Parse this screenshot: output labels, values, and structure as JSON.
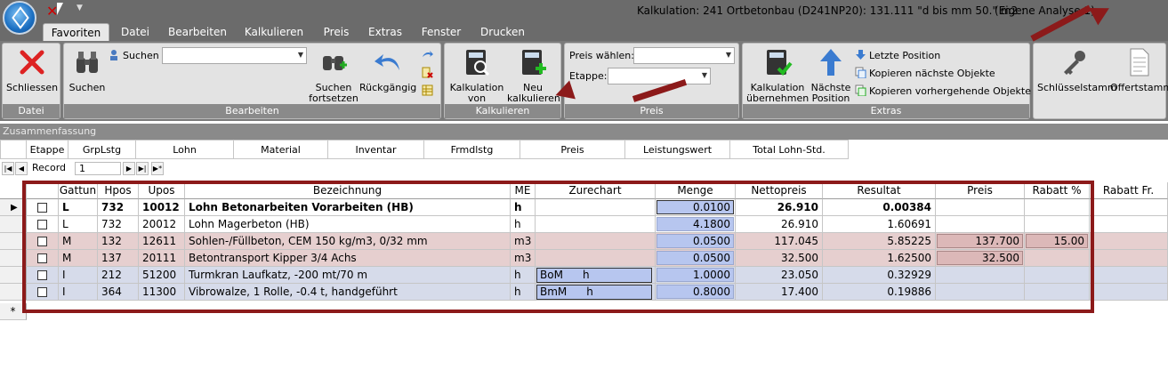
{
  "title": {
    "main": "Kalkulation: 241 Ortbetonbau (D241NP20): 131.111   \"d bis mm 50.\" m2 :",
    "extra": "(Eigene Analyse 1)"
  },
  "tabs": [
    "Favoriten",
    "Datei",
    "Bearbeiten",
    "Kalkulieren",
    "Preis",
    "Extras",
    "Fenster",
    "Drucken"
  ],
  "ribbon": {
    "datei": {
      "label": "Datei",
      "close": "Schliessen"
    },
    "bearbeiten": {
      "label": "Bearbeiten",
      "suchen_big": "Suchen",
      "suchen_small": "Suchen",
      "search_value": "",
      "continue_line1": "Suchen",
      "continue_line2": "fortsetzen",
      "undo": "Rückgängig"
    },
    "kalkulieren": {
      "label": "Kalkulieren",
      "von_line1": "Kalkulation",
      "von_line2": "von",
      "neu_line1": "Neu",
      "neu_line2": "kalkulieren"
    },
    "preis": {
      "label": "Preis",
      "preis_waehlen": "Preis wählen:",
      "preis_value": "",
      "etappe": "Etappe:",
      "etappe_value": ""
    },
    "extras": {
      "label": "Extras",
      "uebernehmen_line1": "Kalkulation",
      "uebernehmen_line2": "übernehmen",
      "naechste_line1": "Nächste",
      "naechste_line2": "Position",
      "letzte": "Letzte Position",
      "kopieren_naechste": "Kopieren nächste Objekte",
      "kopieren_vorher": "Kopieren vorhergehende Objekte"
    },
    "extra2": {
      "schluessel": "Schlüsselstamm",
      "offert": "Offertstamm"
    }
  },
  "summary": {
    "title": "Zusammenfassung",
    "columns": [
      "Etappe",
      "GrpLstg",
      "Lohn",
      "Material",
      "Inventar",
      "Frmdlstg",
      "Preis",
      "Leistungswert",
      "Total Lohn-Std."
    ]
  },
  "navigator": {
    "label": "Record",
    "value": "1"
  },
  "grid": {
    "headers": [
      "Gattun",
      "Hpos",
      "Upos",
      "Bezeichnung",
      "ME",
      "Zurechart",
      "Menge",
      "Nettopreis",
      "Resultat",
      "Preis",
      "Rabatt %",
      "Rabatt Fr."
    ],
    "rows": [
      {
        "g": "L",
        "h": "732",
        "u": "10012",
        "bez": "Lohn Betonarbeiten Vorarbeiten (HB)",
        "me": "h",
        "zur": "",
        "zur2": "",
        "menge": "0.0100",
        "netto": "26.910",
        "res": "0.00384",
        "preis": "",
        "rab": "",
        "rabfr": "",
        "bold": true,
        "tint": "#ffffff"
      },
      {
        "g": "L",
        "h": "732",
        "u": "20012",
        "bez": "Lohn Magerbeton (HB)",
        "me": "h",
        "zur": "",
        "zur2": "",
        "menge": "4.1800",
        "netto": "26.910",
        "res": "1.60691",
        "preis": "",
        "rab": "",
        "rabfr": "",
        "bold": false,
        "tint": "#ffffff"
      },
      {
        "g": "M",
        "h": "132",
        "u": "12611",
        "bez": "Sohlen-/Füllbeton, CEM 150 kg/m3,  0/32 mm",
        "me": "m3",
        "zur": "",
        "zur2": "",
        "menge": "0.0500",
        "netto": "117.045",
        "res": "5.85225",
        "preis": "137.700",
        "rab": "15.00",
        "rabfr": "",
        "bold": false,
        "tint": "#e6cfcf"
      },
      {
        "g": "M",
        "h": "137",
        "u": "20111",
        "bez": "Betontransport Kipper 3/4 Achs",
        "me": "m3",
        "zur": "",
        "zur2": "",
        "menge": "0.0500",
        "netto": "32.500",
        "res": "1.62500",
        "preis": "32.500",
        "rab": "",
        "rabfr": "",
        "bold": false,
        "tint": "#e6cfcf"
      },
      {
        "g": "I",
        "h": "212",
        "u": "51200",
        "bez": "Turmkran Laufkatz, -200 mt/70 m",
        "me": "h",
        "zur": "BoM",
        "zur2": "h",
        "menge": "1.0000",
        "netto": "23.050",
        "res": "0.32929",
        "preis": "",
        "rab": "",
        "rabfr": "",
        "bold": false,
        "tint": "#d6dbea"
      },
      {
        "g": "I",
        "h": "364",
        "u": "11300",
        "bez": "Vibrowalze, 1 Rolle, -0.4 t, handgeführt",
        "me": "h",
        "zur": "BmM",
        "zur2": "h",
        "menge": "0.8000",
        "netto": "17.400",
        "res": "0.19886",
        "preis": "",
        "rab": "",
        "rabfr": "",
        "bold": false,
        "tint": "#d6dbea"
      }
    ],
    "new_row_marker": "*"
  },
  "colors": {
    "accent_red": "#8c1a1a",
    "material_row": "#e6cfcf",
    "inventar_row": "#d6dbea",
    "menge_cell": "#b7c6ef"
  }
}
